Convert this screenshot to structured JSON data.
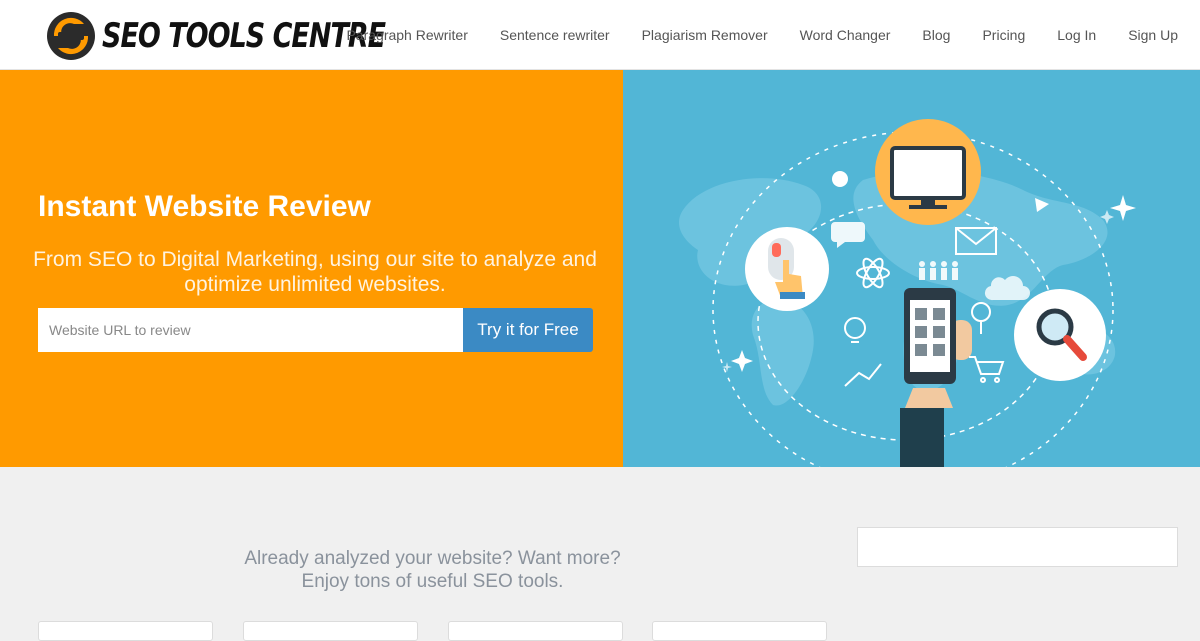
{
  "brand": {
    "name": "SEO TOOLS CENTRE",
    "accent_orange": "#ff9a00",
    "accent_blue": "#52b6d6",
    "button_blue": "#3b8ac4"
  },
  "nav": {
    "items": [
      {
        "label": "Paragraph Rewriter"
      },
      {
        "label": "Sentence rewriter"
      },
      {
        "label": "Plagiarism Remover"
      },
      {
        "label": "Word Changer"
      },
      {
        "label": "Blog"
      },
      {
        "label": "Pricing"
      },
      {
        "label": "Log In"
      },
      {
        "label": "Sign Up"
      }
    ]
  },
  "hero": {
    "title": "Instant Website Review",
    "subtitle": "From SEO to Digital Marketing, using our site to analyze and optimize unlimited websites.",
    "input_placeholder": "Website URL to review",
    "button_label": "Try it for Free",
    "illustration_icons": [
      "monitor-icon",
      "mouse-click-icon",
      "magnifier-icon",
      "smartphone-icon",
      "mail-icon",
      "chat-icon",
      "cloud-icon",
      "atom-icon",
      "people-icon",
      "lightbulb-icon",
      "chart-icon",
      "cart-icon",
      "sparkle-icon"
    ]
  },
  "promo": {
    "line1": "Already analyzed your website? Want more?",
    "line2": "Enjoy tons of useful SEO tools."
  }
}
